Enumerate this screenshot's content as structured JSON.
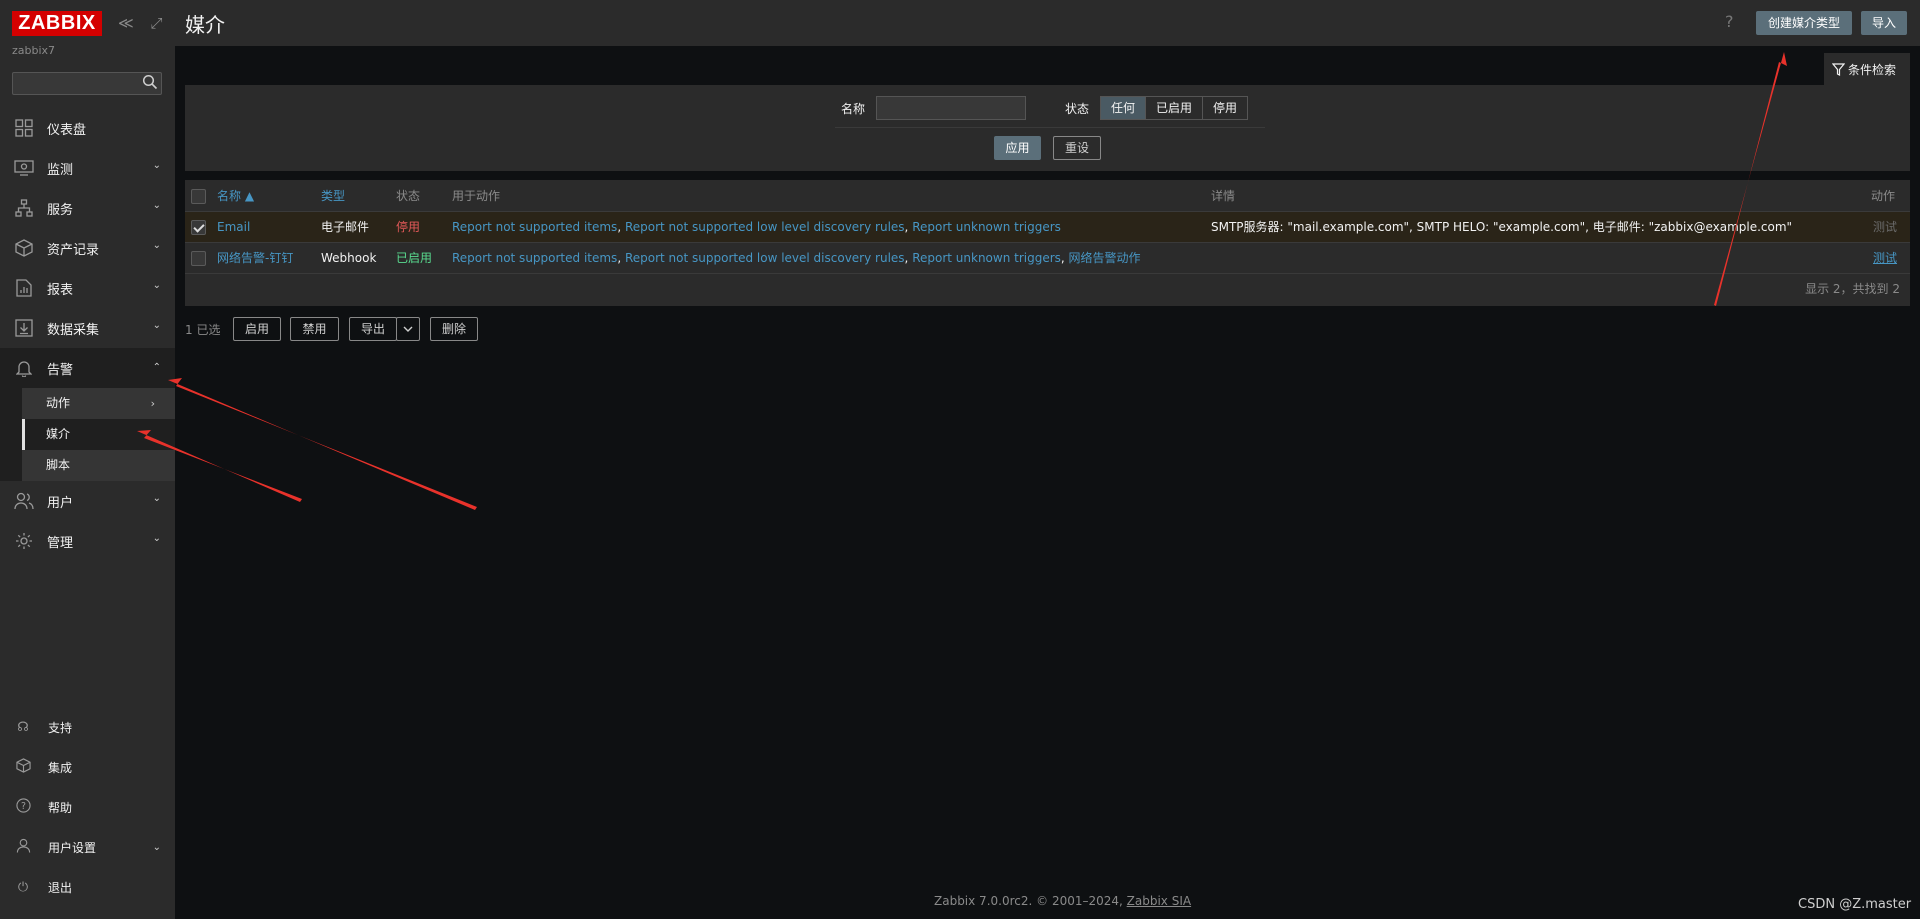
{
  "sidebar": {
    "logo": "ZABBIX",
    "server": "zabbix7",
    "collapse_icons": "≪ ⤢",
    "menu": [
      {
        "label": "仪表盘",
        "icon": "dashboard-icon"
      },
      {
        "label": "监测",
        "icon": "monitoring-icon"
      },
      {
        "label": "服务",
        "icon": "services-icon"
      },
      {
        "label": "资产记录",
        "icon": "inventory-icon"
      },
      {
        "label": "报表",
        "icon": "reports-icon"
      },
      {
        "label": "数据采集",
        "icon": "data-collection-icon"
      },
      {
        "label": "告警",
        "icon": "bell-icon"
      },
      {
        "label": "用户",
        "icon": "users-icon"
      },
      {
        "label": "管理",
        "icon": "gear-icon"
      }
    ],
    "submenu": [
      {
        "label": "动作"
      },
      {
        "label": "媒介"
      },
      {
        "label": "脚本"
      }
    ],
    "bottom": [
      {
        "label": "支持",
        "icon": "headset-icon"
      },
      {
        "label": "集成",
        "icon": "integrations-icon"
      },
      {
        "label": "帮助",
        "icon": "help-icon"
      },
      {
        "label": "用户设置",
        "icon": "user-icon"
      },
      {
        "label": "退出",
        "icon": "power-icon"
      }
    ]
  },
  "header": {
    "title": "媒介",
    "help": "?",
    "create_button": "创建媒介类型",
    "import_button": "导入"
  },
  "filter": {
    "tab_label": "条件检索",
    "name_label": "名称",
    "name_value": "",
    "status_label": "状态",
    "status_options": [
      "任何",
      "已启用",
      "停用"
    ],
    "status_selected": "任何",
    "apply": "应用",
    "reset": "重设"
  },
  "table": {
    "headers": {
      "name": "名称 ▲",
      "type": "类型",
      "status": "状态",
      "used_in": "用于动作",
      "details": "详情",
      "action": "动作"
    },
    "rows": [
      {
        "name": "Email",
        "type": "电子邮件",
        "status": "停用",
        "actions": [
          "Report not supported items",
          "Report not supported low level discovery rules",
          "Report unknown triggers"
        ],
        "details": "SMTP服务器: \"mail.example.com\", SMTP HELO: \"example.com\", 电子邮件: \"zabbix@example.com\"",
        "test": "测试",
        "checked": true
      },
      {
        "name": "网络告警-钉钉",
        "type": "Webhook",
        "status": "已启用",
        "actions": [
          "Report not supported items",
          "Report not supported low level discovery rules",
          "Report unknown triggers",
          "网络告警动作"
        ],
        "details": "",
        "test": "测试",
        "checked": false
      }
    ],
    "footer": "显示 2，共找到 2"
  },
  "bulk": {
    "selected": "1 已选",
    "enable": "启用",
    "disable": "禁用",
    "export": "导出",
    "delete": "删除"
  },
  "footer": {
    "text": "Zabbix 7.0.0rc2. © 2001–2024, ",
    "company": "Zabbix SIA"
  },
  "watermark": "CSDN @Z.master",
  "colors": {
    "accent": "#5b6f7a",
    "link": "#4796c4",
    "disabled": "#e45959",
    "enabled": "#59db8f",
    "logo": "#d40000",
    "annotation": "#e8322b"
  }
}
